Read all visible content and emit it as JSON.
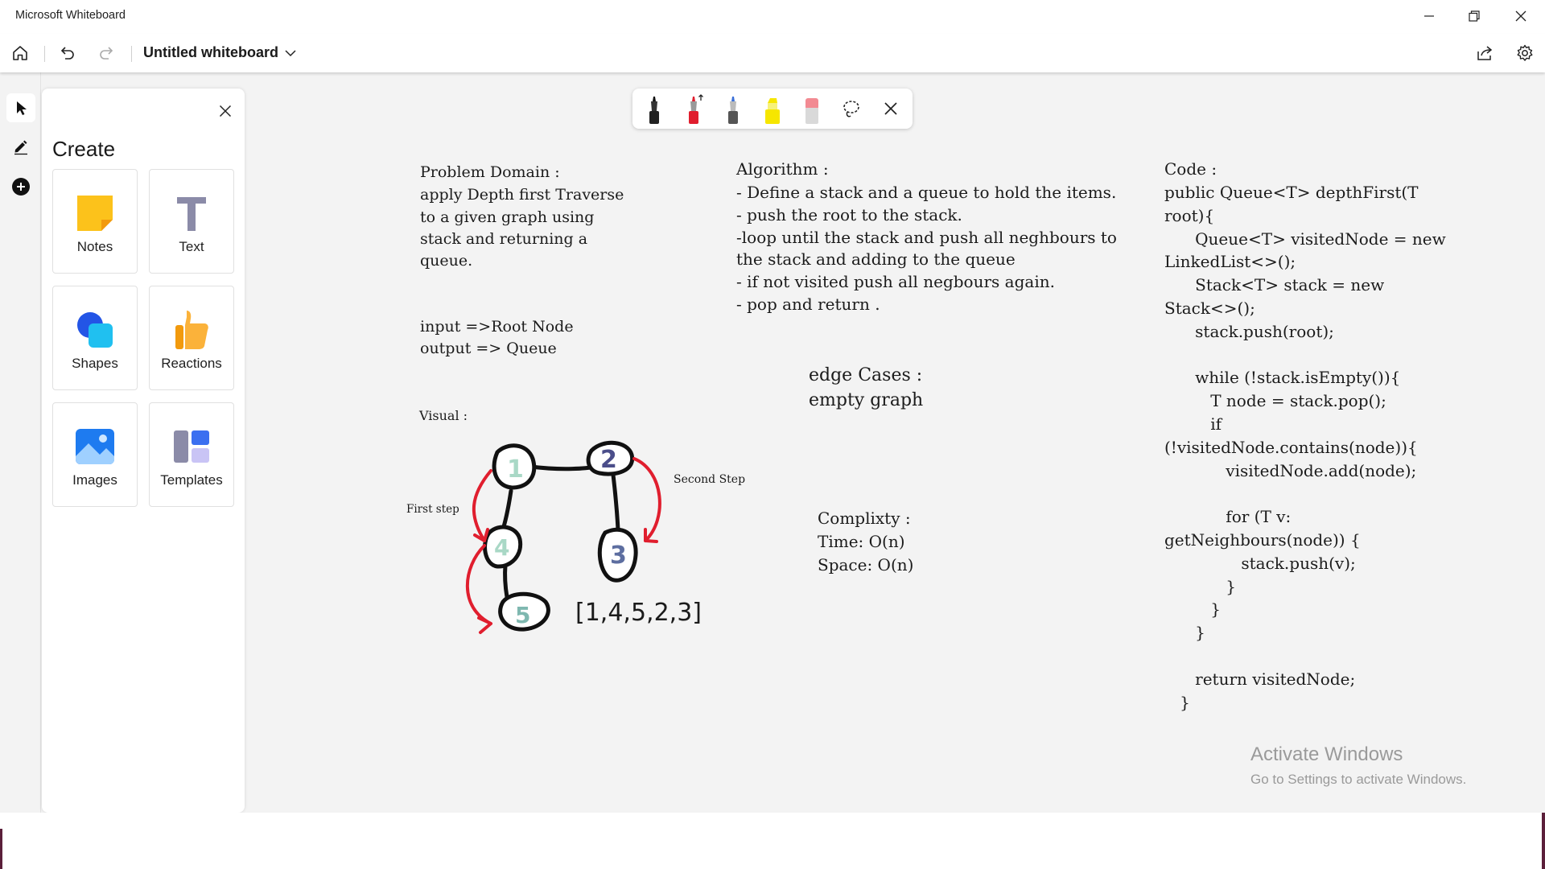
{
  "window": {
    "title": "Microsoft Whiteboard"
  },
  "toolbar": {
    "board_title": "Untitled whiteboard"
  },
  "panel": {
    "title": "Create",
    "tiles": [
      {
        "label": "Notes",
        "icon": "sticky-note-icon"
      },
      {
        "label": "Text",
        "icon": "text-icon"
      },
      {
        "label": "Shapes",
        "icon": "shapes-icon"
      },
      {
        "label": "Reactions",
        "icon": "thumbs-up-icon"
      },
      {
        "label": "Images",
        "icon": "image-icon"
      },
      {
        "label": "Templates",
        "icon": "templates-icon"
      }
    ]
  },
  "board": {
    "problem": {
      "heading": "Problem Domain :",
      "lines": [
        "apply Depth first Traverse",
        "to a given graph using",
        "stack and returning a",
        "queue."
      ]
    },
    "io": {
      "input": "input =>Root Node",
      "output": "output => Queue"
    },
    "visual": {
      "heading": "Visual :",
      "first_step": "First step",
      "second_step": "Second Step",
      "result": "[1,4,5,2,3]",
      "nodes": [
        "1",
        "2",
        "3",
        "4",
        "5"
      ]
    },
    "algorithm": {
      "heading": "Algorithm :",
      "lines": [
        "- Define a stack and a queue to hold the items.",
        "- push the root to the stack.",
        "-loop until the stack and push all neghbours to",
        "the stack and adding to the queue",
        "- if not visited push all negbours again.",
        "- pop and return ."
      ]
    },
    "edge": {
      "heading": "edge Cases :",
      "text": "empty graph"
    },
    "complexity": {
      "heading": "Complixty :",
      "time": "Time: O(n)",
      "space": "Space: O(n)"
    },
    "code": {
      "heading": "Code :",
      "lines": [
        "public Queue<T> depthFirst(T",
        "root){",
        "      Queue<T> visitedNode = new",
        "LinkedList<>();",
        "      Stack<T> stack = new",
        "Stack<>();",
        "      stack.push(root);",
        "",
        "      while (!stack.isEmpty()){",
        "         T node = stack.pop();",
        "         if",
        "(!visitedNode.contains(node)){",
        "            visitedNode.add(node);",
        "",
        "            for (T v:",
        "getNeighbours(node)) {",
        "               stack.push(v);",
        "            }",
        "         }",
        "      }",
        "",
        "      return visitedNode;",
        "   }"
      ]
    }
  },
  "watermark": {
    "title": "Activate Windows",
    "subtitle": "Go to Settings to activate Windows."
  },
  "colors": {
    "accent_red": "#e01e2e",
    "canvas": "#f3f3f3",
    "ink": "#111111"
  }
}
